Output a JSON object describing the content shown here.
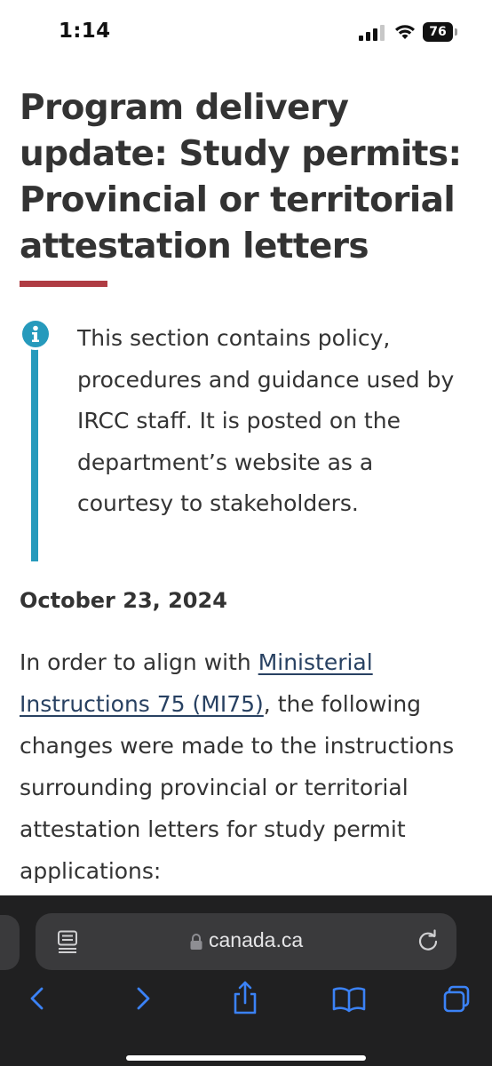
{
  "status_bar": {
    "time": "1:14",
    "battery": "76"
  },
  "page": {
    "title": "Program delivery update: Study permits: Provincial or territorial attestation letters",
    "accent_color": "#af3c43",
    "info_color": "#269abc",
    "info_text": "This section contains policy, procedures and guidance used by IRCC staff. It is posted on the department’s website as a courtesy to stakeholders.",
    "date": "October 23, 2024",
    "para_before_link": "In order to align with ",
    "link_text": "Ministerial Instructions 75 (MI75)",
    "para_after_link": ", the following changes were made to the instructions surrounding provincial or territorial attestation letters for study permit applications:"
  },
  "browser": {
    "url": "canada.ca",
    "icons": [
      "reader-icon",
      "lock-icon",
      "reload-icon",
      "back-icon",
      "forward-icon",
      "share-icon",
      "bookmarks-icon",
      "tabs-icon"
    ]
  }
}
